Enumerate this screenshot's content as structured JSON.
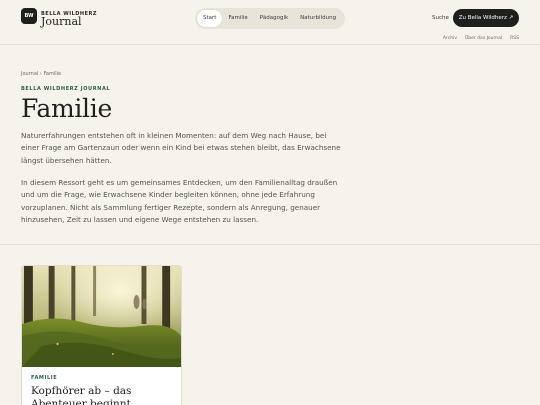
{
  "header": {
    "logo_mark": "BW",
    "brand_small": "BELLA WILDHERZ",
    "brand_big": "Journal",
    "nav": [
      {
        "label": "Start",
        "active": true
      },
      {
        "label": "Familie",
        "active": false
      },
      {
        "label": "Pädagogik",
        "active": false
      },
      {
        "label": "Naturbildung",
        "active": false
      }
    ],
    "search": "Suche",
    "cta": "Zu Bella Wildherz ↗",
    "subnav": [
      "Archiv",
      "Über das Journal",
      "RSS"
    ]
  },
  "main": {
    "breadcrumb": "Journal › Familie",
    "kicker": "BELLA WILDHERZ JOURNAL",
    "title": "Familie",
    "lead": "Naturerfahrungen entstehen oft in kleinen Momenten: auf dem Weg nach Hause, bei einer Frage am Gartenzaun oder wenn ein Kind bei etwas stehen bleibt, das Erwachsene längst übersehen hätten.",
    "body": "In diesem Ressort geht es um gemeinsames Entdecken, um den Familienalltag draußen und um die Frage, wie Erwachsene Kinder begleiten können, ohne jede Erfahrung vorzuplanen. Nicht als Sammlung fertiger Rezepte, sondern als Anregung, genauer hinzusehen, Zeit zu lassen und eigene Wege entstehen zu lassen."
  },
  "card": {
    "kicker": "FAMILIE",
    "title": "Kopfhörer ab – das Abenteuer beginnt"
  },
  "colors": {
    "background": "#f6f3ec",
    "accent": "#2f5d4a",
    "dark": "#1f1f1f"
  }
}
